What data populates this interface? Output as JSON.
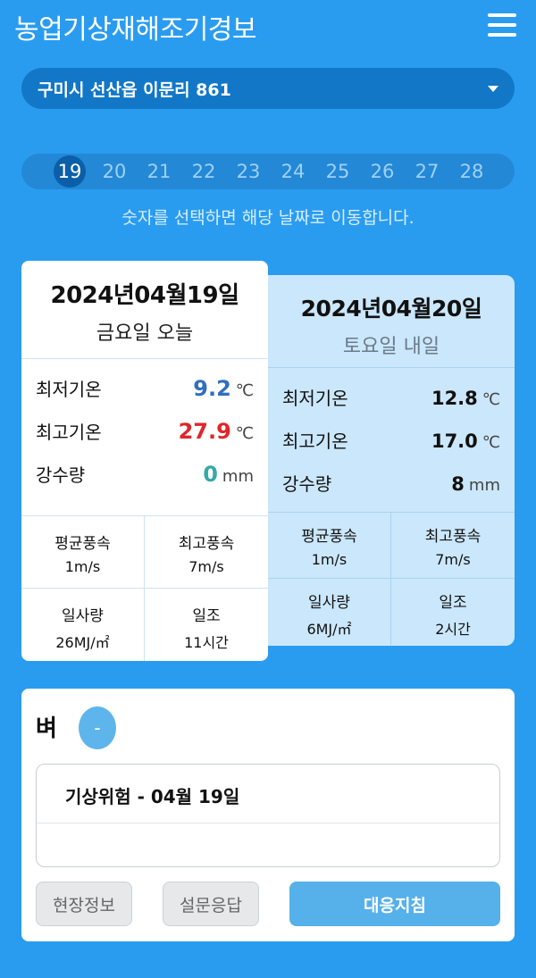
{
  "header": {
    "title": "농업기상재해조기경보",
    "menu_icon": "hamburger-menu-icon"
  },
  "location": {
    "selected": "구미시 선산읍 이문리 861"
  },
  "dates": {
    "items": [
      "19",
      "20",
      "21",
      "22",
      "23",
      "24",
      "25",
      "26",
      "27",
      "28"
    ],
    "active": "19"
  },
  "hint": "숫자를 선택하면 해당 날짜로 이동합니다.",
  "today": {
    "date": "2024년04월19일",
    "day": "금요일 오늘",
    "min_label": "최저기온",
    "min_value": "9.2",
    "min_unit": "℃",
    "max_label": "최고기온",
    "max_value": "27.9",
    "max_unit": "℃",
    "rain_label": "강수량",
    "rain_value": "0",
    "rain_unit": "mm",
    "avg_wind_label": "평균풍속",
    "avg_wind_value": "1m/s",
    "max_wind_label": "최고풍속",
    "max_wind_value": "7m/s",
    "solar_label": "일사량",
    "solar_value": "26MJ/㎡",
    "sunshine_label": "일조",
    "sunshine_value": "11시간"
  },
  "tomorrow": {
    "date": "2024년04월20일",
    "day": "토요일 내일",
    "min_label": "최저기온",
    "min_value": "12.8",
    "min_unit": "℃",
    "max_label": "최고기온",
    "max_value": "17.0",
    "max_unit": "℃",
    "rain_label": "강수량",
    "rain_value": "8",
    "rain_unit": "mm",
    "avg_wind_label": "평균풍속",
    "avg_wind_value": "1m/s",
    "max_wind_label": "최고풍속",
    "max_wind_value": "7m/s",
    "solar_label": "일사량",
    "solar_value": "6MJ/㎡",
    "sunshine_label": "일조",
    "sunshine_value": "2시간"
  },
  "crop": {
    "name": "벼",
    "badge": "-",
    "risk_title": "기상위험 - 04월 19일",
    "field_button": "현장정보",
    "survey_button": "설문응답",
    "guide_button": "대응지침"
  },
  "colors": {
    "background": "#2a9cf0",
    "min_temp": "#2f6fbd",
    "max_temp": "#e0262a",
    "rain": "#36a9a6"
  }
}
